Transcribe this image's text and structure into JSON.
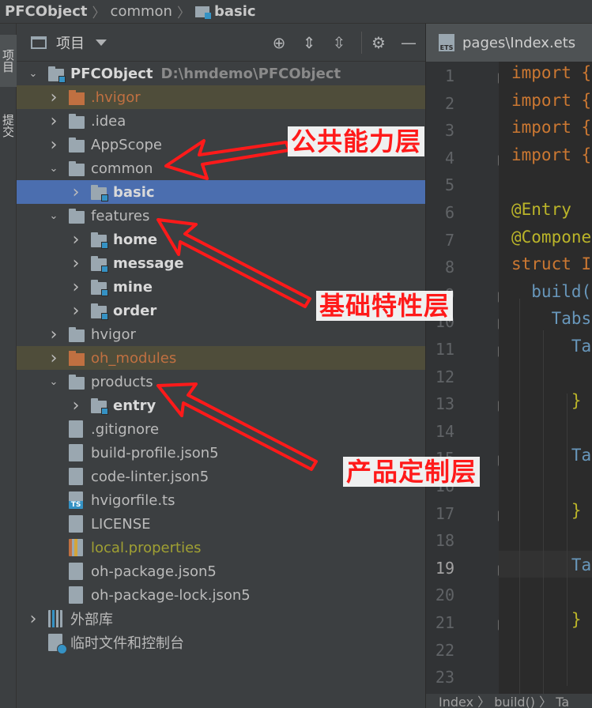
{
  "breadcrumb": {
    "items": [
      "PFCObject",
      "common",
      "basic"
    ]
  },
  "side_tabs": [
    "项目",
    "提交"
  ],
  "panel": {
    "title": "项目"
  },
  "tree": [
    {
      "label": "PFCObject",
      "path": "D:\\hmdemo\\PFCObject",
      "kind": "module",
      "depth": 0,
      "arrow": "down",
      "style": "bold"
    },
    {
      "label": ".hvigor",
      "kind": "folder-orange",
      "depth": 1,
      "arrow": "right",
      "style": "orange",
      "hl": true
    },
    {
      "label": ".idea",
      "kind": "folder",
      "depth": 1,
      "arrow": "right",
      "style": "normal"
    },
    {
      "label": "AppScope",
      "kind": "folder",
      "depth": 1,
      "arrow": "right",
      "style": "normal"
    },
    {
      "label": "common",
      "kind": "folder",
      "depth": 1,
      "arrow": "down",
      "style": "normal"
    },
    {
      "label": "basic",
      "kind": "module",
      "depth": 2,
      "arrow": "right",
      "style": "bold",
      "selected": true
    },
    {
      "label": "features",
      "kind": "folder",
      "depth": 1,
      "arrow": "down",
      "style": "normal"
    },
    {
      "label": "home",
      "kind": "module",
      "depth": 2,
      "arrow": "right",
      "style": "bold"
    },
    {
      "label": "message",
      "kind": "module",
      "depth": 2,
      "arrow": "right",
      "style": "bold"
    },
    {
      "label": "mine",
      "kind": "module",
      "depth": 2,
      "arrow": "right",
      "style": "bold"
    },
    {
      "label": "order",
      "kind": "module",
      "depth": 2,
      "arrow": "right",
      "style": "bold"
    },
    {
      "label": "hvigor",
      "kind": "folder",
      "depth": 1,
      "arrow": "right",
      "style": "normal"
    },
    {
      "label": "oh_modules",
      "kind": "folder-orange",
      "depth": 1,
      "arrow": "right",
      "style": "orange",
      "hl": true
    },
    {
      "label": "products",
      "kind": "folder",
      "depth": 1,
      "arrow": "down",
      "style": "normal"
    },
    {
      "label": "entry",
      "kind": "module",
      "depth": 2,
      "arrow": "right",
      "style": "bold"
    },
    {
      "label": ".gitignore",
      "kind": "file",
      "depth": 1,
      "style": "normal"
    },
    {
      "label": "build-profile.json5",
      "kind": "file",
      "depth": 1,
      "style": "normal"
    },
    {
      "label": "code-linter.json5",
      "kind": "file",
      "depth": 1,
      "style": "normal"
    },
    {
      "label": "hvigorfile.ts",
      "kind": "file-ts",
      "depth": 1,
      "style": "normal"
    },
    {
      "label": "LICENSE",
      "kind": "file",
      "depth": 1,
      "style": "normal"
    },
    {
      "label": "local.properties",
      "kind": "file",
      "depth": 1,
      "style": "olive"
    },
    {
      "label": "oh-package.json5",
      "kind": "file",
      "depth": 1,
      "style": "normal"
    },
    {
      "label": "oh-package-lock.json5",
      "kind": "file",
      "depth": 1,
      "style": "normal"
    },
    {
      "label": "外部库",
      "kind": "lib",
      "depth": 0,
      "arrow": "right",
      "style": "normal"
    },
    {
      "label": "临时文件和控制台",
      "kind": "scratch",
      "depth": 0,
      "style": "normal"
    }
  ],
  "editor": {
    "tab_label": "pages\\Index.ets",
    "line_numbers": [
      "1",
      "2",
      "3",
      "4",
      "5",
      "6",
      "7",
      "8",
      "9",
      "10",
      "11",
      "12",
      "13",
      "14",
      "15",
      "16",
      "17",
      "18",
      "19",
      "20",
      "21",
      "22",
      "23"
    ],
    "current_line": "19",
    "code_lines": [
      {
        "n": 1,
        "text": "import {",
        "cls": "kw"
      },
      {
        "n": 2,
        "text": "import {",
        "cls": "kw"
      },
      {
        "n": 3,
        "text": "import {",
        "cls": "kw"
      },
      {
        "n": 4,
        "text": "import {",
        "cls": "kw"
      },
      {
        "n": 6,
        "text": "@Entry",
        "cls": "ann"
      },
      {
        "n": 7,
        "text": "@Component",
        "cls": "ann"
      },
      {
        "n": 8,
        "text": "struct In",
        "cls": "kw"
      },
      {
        "n": 9,
        "text": "  build()",
        "cls": "idt"
      },
      {
        "n": 10,
        "text": "    Tabs",
        "cls": "idt"
      },
      {
        "n": 11,
        "text": "      Ta",
        "cls": "idt"
      },
      {
        "n": 13,
        "text": "      }",
        "cls": "ann"
      },
      {
        "n": 15,
        "text": "      Ta",
        "cls": "idt"
      },
      {
        "n": 17,
        "text": "      }",
        "cls": "ann"
      },
      {
        "n": 19,
        "text": "      Ta",
        "cls": "idt"
      },
      {
        "n": 21,
        "text": "      }",
        "cls": "ann"
      }
    ],
    "bottom_crumbs": "Index 〉 build() 〉 Ta"
  },
  "annotations": [
    "公共能力层",
    "基础特性层",
    "产品定制层"
  ],
  "colors": {
    "selected_row": "#4b6eaf",
    "annotation": "#ff1a1a",
    "ignored": "#c07041",
    "module_badge": "#3592c4"
  }
}
